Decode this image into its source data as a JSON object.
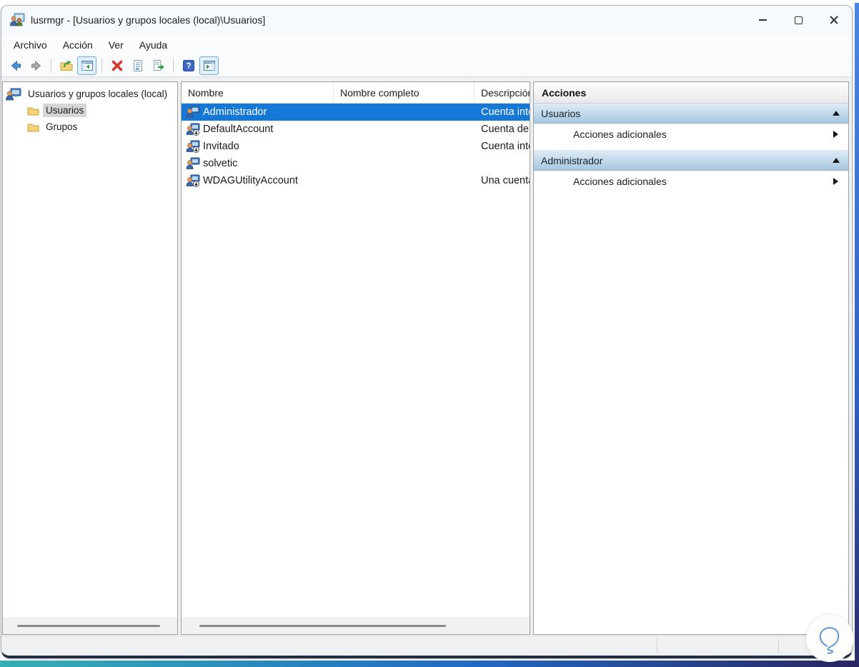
{
  "window": {
    "title": "lusrmgr - [Usuarios y grupos locales (local)\\Usuarios]",
    "controls": {
      "minimize": "minimize",
      "maximize": "maximize",
      "close": "close"
    }
  },
  "menu": {
    "items": [
      {
        "label": "Archivo"
      },
      {
        "label": "Acción"
      },
      {
        "label": "Ver"
      },
      {
        "label": "Ayuda"
      }
    ]
  },
  "toolbar": {
    "icons": [
      "back",
      "forward",
      "up-one-level",
      "show-hide-console-tree",
      "delete",
      "properties",
      "export-list",
      "help",
      "show-hide-action-pane"
    ],
    "active_toggles": [
      "show-hide-console-tree",
      "show-hide-action-pane"
    ]
  },
  "tree": {
    "root": {
      "label": "Usuarios y grupos locales (local)",
      "icon": "users-computer-icon"
    },
    "items": [
      {
        "label": "Usuarios",
        "icon": "folder-icon",
        "selected": true
      },
      {
        "label": "Grupos",
        "icon": "folder-icon",
        "selected": false
      }
    ]
  },
  "list": {
    "columns": [
      "Nombre",
      "Nombre completo",
      "Descripción"
    ],
    "rows": [
      {
        "name": "Administrador",
        "full_name": "",
        "description": "Cuenta inte",
        "selected": true,
        "disabled": false
      },
      {
        "name": "DefaultAccount",
        "full_name": "",
        "description": "Cuenta de u",
        "selected": false,
        "disabled": true
      },
      {
        "name": "Invitado",
        "full_name": "",
        "description": "Cuenta inte",
        "selected": false,
        "disabled": true
      },
      {
        "name": "solvetic",
        "full_name": "",
        "description": "",
        "selected": false,
        "disabled": false
      },
      {
        "name": "WDAGUtilityAccount",
        "full_name": "",
        "description": "Una cuenta",
        "selected": false,
        "disabled": true
      }
    ]
  },
  "actions_pane": {
    "title": "Acciones",
    "sections": [
      {
        "title": "Usuarios",
        "collapsed": false,
        "items": [
          {
            "label": "Acciones adicionales"
          }
        ]
      },
      {
        "title": "Administrador",
        "collapsed": false,
        "items": [
          {
            "label": "Acciones adicionales"
          }
        ]
      }
    ]
  },
  "colors": {
    "selection_blue": "#1577d6",
    "section_header_gradient_top": "#ddecf7",
    "section_header_gradient_bottom": "#a7c7df",
    "titlebar_bg": "#f7fafd",
    "content_bg": "#eef0f2",
    "frame_bottom_gradient": [
      "#35b0b4",
      "#2169c6",
      "#2b2560"
    ],
    "delete_red": "#d6342a",
    "watermark_blue": "#6b9bd2"
  }
}
